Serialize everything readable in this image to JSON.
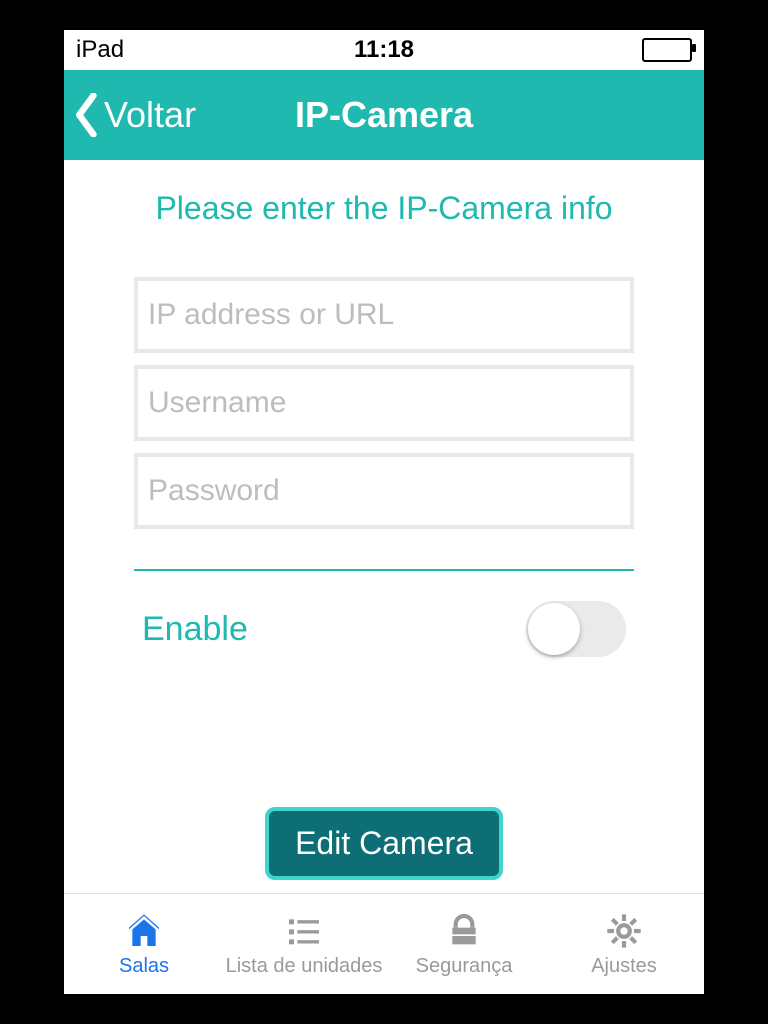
{
  "statusbar": {
    "device": "iPad",
    "time": "11:18"
  },
  "navbar": {
    "back": "Voltar",
    "title": "IP-Camera"
  },
  "main": {
    "prompt": "Please enter the IP-Camera info",
    "ip_placeholder": "IP address or URL",
    "username_placeholder": "Username",
    "password_placeholder": "Password",
    "enable_label": "Enable",
    "edit_button": "Edit Camera"
  },
  "tabs": {
    "salas": "Salas",
    "lista": "Lista de unidades",
    "seguranca": "Segurança",
    "ajustes": "Ajustes"
  }
}
